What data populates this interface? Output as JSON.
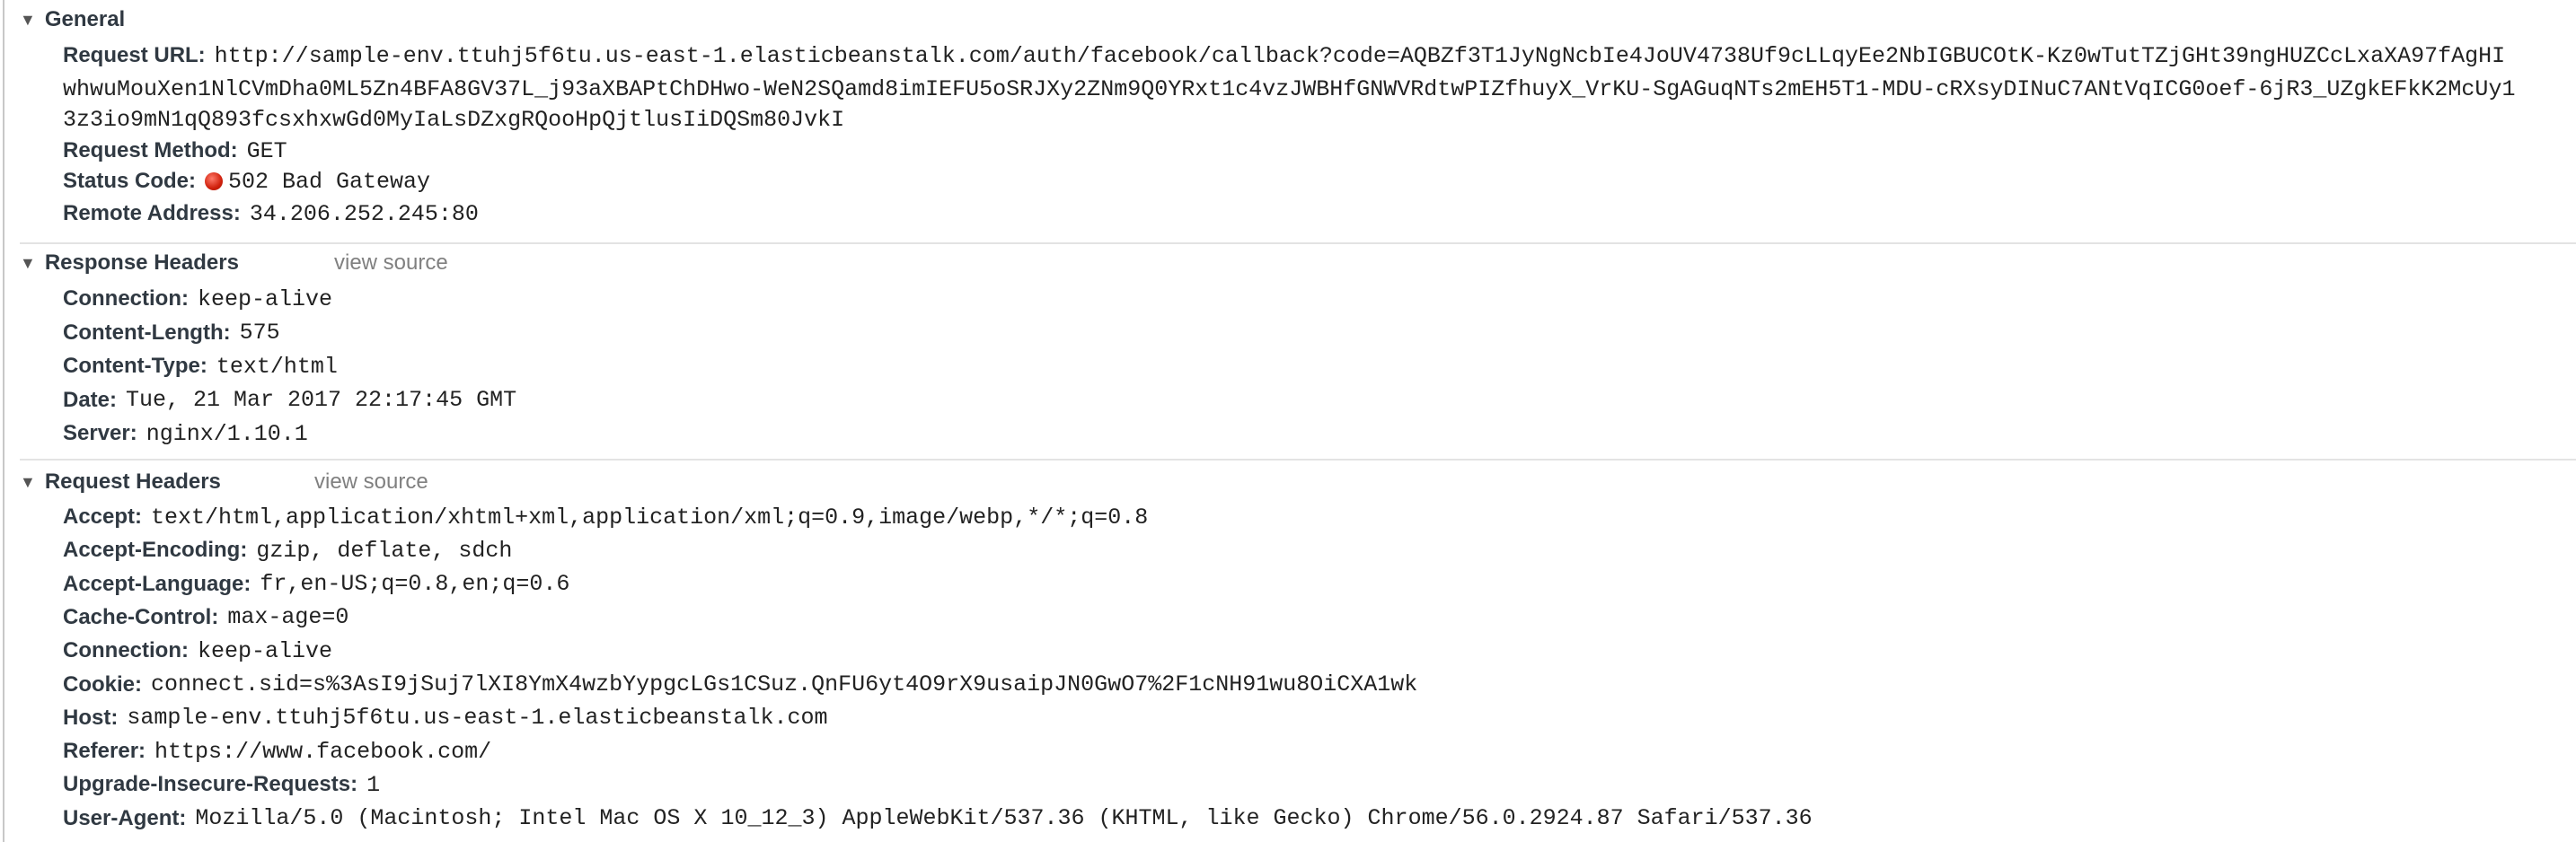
{
  "general": {
    "title": "General",
    "request_url_label": "Request URL:",
    "request_url_lines": [
      "http://sample-env.ttuhj5f6tu.us-east-1.elasticbeanstalk.com/auth/facebook/callback?code=AQBZf3T1JyNgNcbIe4JoUV4738Uf9cLLqyEe2NbIGBUCOtK-Kz0wTutTZjGHt39ngHUZCcLxaXA97fAgHI",
      "whwuMouXen1NlCVmDha0ML5Zn4BFA8GV37L_j93aXBAPtChDHwo-WeN2SQamd8imIEFU5oSRJXy2ZNm9Q0YRxt1c4vzJWBHfGNWVRdtwPIZfhuyX_VrKU-SgAGuqNTs2mEH5T1-MDU-cRXsyDINuC7ANtVqICG0oef-6jR3_UZgkEFkK2McUy1",
      "3z3io9mN1qQ893fcsxhxwGd0MyIaLsDZxgRQooHpQjtlusIiDQSm80JvkI"
    ],
    "request_method_label": "Request Method:",
    "request_method": "GET",
    "status_code_label": "Status Code:",
    "status_code": "502 Bad Gateway",
    "status_color": "#d0200c",
    "remote_address_label": "Remote Address:",
    "remote_address": "34.206.252.245:80"
  },
  "response_headers": {
    "title": "Response Headers",
    "view_source": "view source",
    "items": [
      {
        "name": "Connection:",
        "value": "keep-alive"
      },
      {
        "name": "Content-Length:",
        "value": "575"
      },
      {
        "name": "Content-Type:",
        "value": "text/html"
      },
      {
        "name": "Date:",
        "value": "Tue, 21 Mar 2017 22:17:45 GMT"
      },
      {
        "name": "Server:",
        "value": "nginx/1.10.1"
      }
    ]
  },
  "request_headers": {
    "title": "Request Headers",
    "view_source": "view source",
    "items": [
      {
        "name": "Accept:",
        "value": "text/html,application/xhtml+xml,application/xml;q=0.9,image/webp,*/*;q=0.8"
      },
      {
        "name": "Accept-Encoding:",
        "value": "gzip, deflate, sdch"
      },
      {
        "name": "Accept-Language:",
        "value": "fr,en-US;q=0.8,en;q=0.6"
      },
      {
        "name": "Cache-Control:",
        "value": "max-age=0"
      },
      {
        "name": "Connection:",
        "value": "keep-alive"
      },
      {
        "name": "Cookie:",
        "value": "connect.sid=s%3AsI9jSuj7lXI8YmX4wzbYypgcLGs1CSuz.QnFU6yt4O9rX9usaipJN0GwO7%2F1cNH91wu8OiCXA1wk"
      },
      {
        "name": "Host:",
        "value": "sample-env.ttuhj5f6tu.us-east-1.elasticbeanstalk.com"
      },
      {
        "name": "Referer:",
        "value": "https://www.facebook.com/"
      },
      {
        "name": "Upgrade-Insecure-Requests:",
        "value": "1"
      },
      {
        "name": "User-Agent:",
        "value": "Mozilla/5.0 (Macintosh; Intel Mac OS X 10_12_3) AppleWebKit/537.36 (KHTML, like Gecko) Chrome/56.0.2924.87 Safari/537.36"
      }
    ]
  }
}
